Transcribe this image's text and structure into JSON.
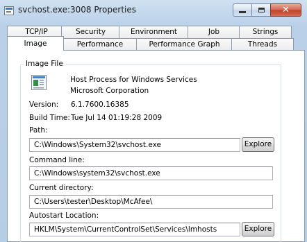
{
  "window": {
    "title": "svchost.exe:3008 Properties",
    "icon": "window-app-icon",
    "controls": [
      "minimize-icon",
      "maximize-icon",
      "close-icon"
    ]
  },
  "tabs": {
    "row1": [
      "TCP/IP",
      "Security",
      "Environment",
      "Job",
      "Strings"
    ],
    "row2": [
      "Image",
      "Performance",
      "Performance Graph",
      "Threads"
    ],
    "active": "Image"
  },
  "image_file": {
    "legend": "Image File",
    "description": "Host Process for Windows Services",
    "company": "Microsoft Corporation",
    "version_label": "Version:",
    "version_value": "6.1.7600.16385",
    "build_time_label": "Build Time:",
    "build_time_value": "Tue Jul 14 01:19:28 2009",
    "path_label": "Path:",
    "path_value": "C:\\Windows\\System32\\svchost.exe",
    "command_line_label": "Command line:",
    "command_line_value": "C:\\Windows\\system32\\svchost.exe",
    "current_directory_label": "Current directory:",
    "current_directory_value": "C:\\Users\\tester\\Desktop\\McAfee\\",
    "autostart_label": "Autostart Location:",
    "autostart_value": "HKLM\\System\\CurrentControlSet\\Services\\lmhosts",
    "explore_label": "Explore"
  }
}
